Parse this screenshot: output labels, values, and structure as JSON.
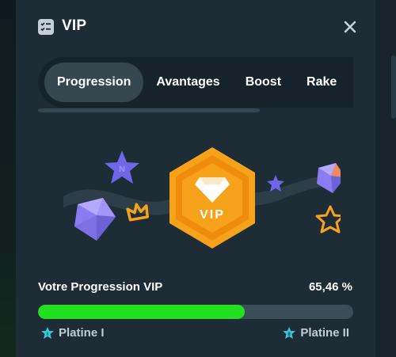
{
  "header": {
    "title": "VIP",
    "icon": "checklist-icon",
    "close_icon": "close-icon"
  },
  "tabs": [
    {
      "label": "Progression",
      "active": true
    },
    {
      "label": "Avantages",
      "active": false
    },
    {
      "label": "Boost",
      "active": false
    },
    {
      "label": "Rake",
      "active": false
    }
  ],
  "badge": {
    "label": "VIP",
    "icon": "diamond-icon"
  },
  "progress": {
    "label": "Votre Progression VIP",
    "value_text": "65,46 %",
    "fraction": 0.6546
  },
  "levels": {
    "current": "Platine I",
    "next": "Platine II"
  },
  "colors": {
    "panel": "#1d2c35",
    "accent_orange": "#f7a21b",
    "progress_green": "#22e01f",
    "gem_purple": "#8a7cf0",
    "level_icon": "#37c7d8"
  }
}
